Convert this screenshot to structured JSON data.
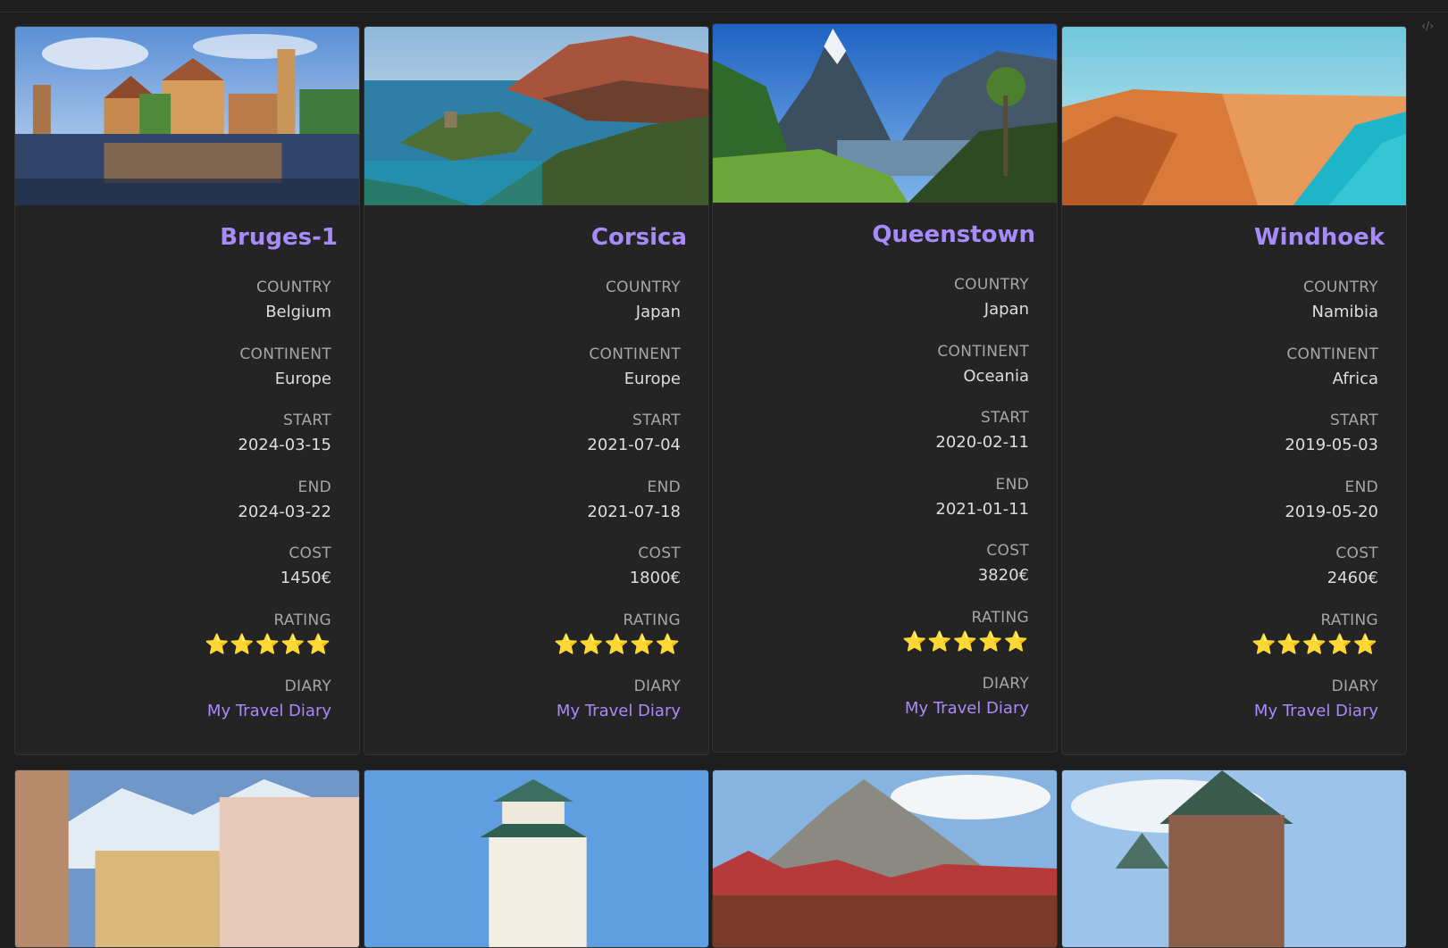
{
  "cards": [
    {
      "title": "Bruges-1",
      "image_icon": "canal-town-photo",
      "props": {
        "country_label": "COUNTRY",
        "country": "Belgium",
        "continent_label": "CONTINENT",
        "continent": "Europe",
        "start_label": "START",
        "start": "2024-03-15",
        "end_label": "END",
        "end": "2024-03-22",
        "cost_label": "COST",
        "cost": "1450€",
        "rating_label": "RATING",
        "rating": "⭐⭐⭐⭐⭐",
        "diary_label": "DIARY",
        "diary": "My Travel Diary"
      }
    },
    {
      "title": "Corsica",
      "image_icon": "coastline-photo",
      "props": {
        "country_label": "COUNTRY",
        "country": "Japan",
        "continent_label": "CONTINENT",
        "continent": "Europe",
        "start_label": "START",
        "start": "2021-07-04",
        "end_label": "END",
        "end": "2021-07-18",
        "cost_label": "COST",
        "cost": "1800€",
        "rating_label": "RATING",
        "rating": "⭐⭐⭐⭐⭐",
        "diary_label": "DIARY",
        "diary": "My Travel Diary"
      }
    },
    {
      "title": "Queenstown",
      "image_icon": "fjord-mountains-photo",
      "props": {
        "country_label": "COUNTRY",
        "country": "Japan",
        "continent_label": "CONTINENT",
        "continent": "Oceania",
        "start_label": "START",
        "start": "2020-02-11",
        "end_label": "END",
        "end": "2021-01-11",
        "cost_label": "COST",
        "cost": "3820€",
        "rating_label": "RATING",
        "rating": "⭐⭐⭐⭐⭐",
        "diary_label": "DIARY",
        "diary": "My Travel Diary"
      }
    },
    {
      "title": "Windhoek",
      "image_icon": "desert-dunes-ocean-photo",
      "props": {
        "country_label": "COUNTRY",
        "country": "Namibia",
        "continent_label": "CONTINENT",
        "continent": "Africa",
        "start_label": "START",
        "start": "2019-05-03",
        "end_label": "END",
        "end": "2019-05-20",
        "cost_label": "COST",
        "cost": "2460€",
        "rating_label": "RATING",
        "rating": "⭐⭐⭐⭐⭐",
        "diary_label": "DIARY",
        "diary": "My Travel Diary"
      }
    }
  ],
  "second_row_images": [
    "alpine-town-photo",
    "japanese-castle-photo",
    "mountain-village-photo",
    "chateau-photo"
  ],
  "colors": {
    "accent": "#a88bfa",
    "background": "#1e1e1e",
    "card": "#242424",
    "star": "#f5c518"
  },
  "corner_icon": "code-icon"
}
